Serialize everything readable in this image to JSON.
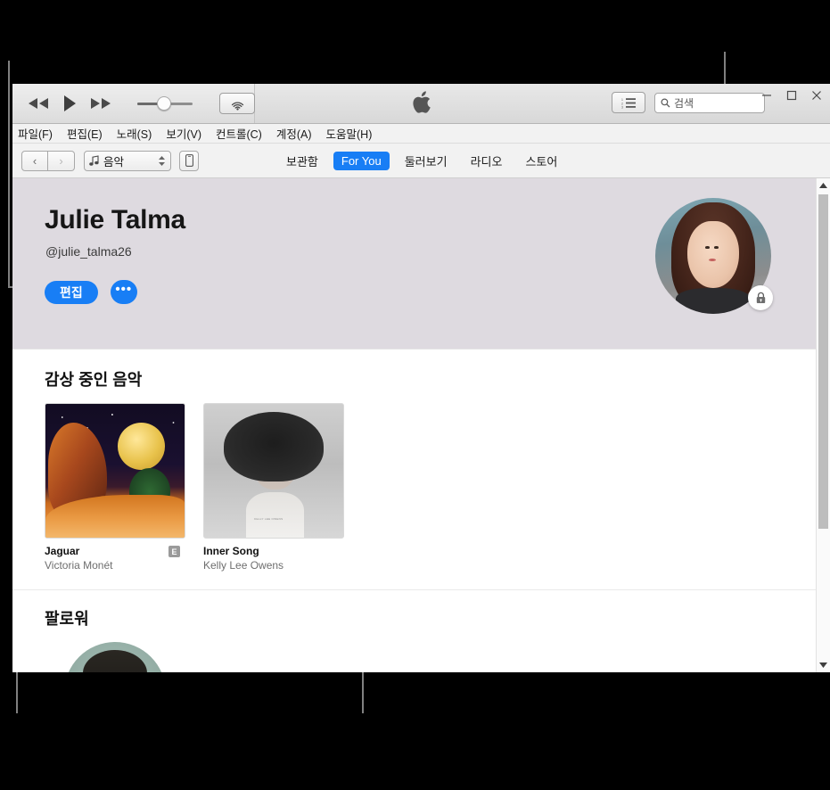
{
  "window": {
    "controls": {
      "minimize": "–",
      "maximize": "□",
      "close": "✕"
    }
  },
  "transport": {
    "rewind_label": "Rewind",
    "play_label": "Play",
    "forward_label": "Fast Forward",
    "volume_label": "Volume",
    "airplay_label": "AirPlay"
  },
  "toolbar": {
    "list_view_label": "List View",
    "search": {
      "placeholder": "검색",
      "value": ""
    }
  },
  "menubar": {
    "items": [
      {
        "label": "파일(F)"
      },
      {
        "label": "편집(E)"
      },
      {
        "label": "노래(S)"
      },
      {
        "label": "보기(V)"
      },
      {
        "label": "컨트롤(C)"
      },
      {
        "label": "계정(A)"
      },
      {
        "label": "도움말(H)"
      }
    ]
  },
  "navbar": {
    "back_label": "‹",
    "forward_label": "›",
    "source": {
      "label": "음악",
      "icon": "music-note-icon"
    },
    "device_label": "Device",
    "tabs": [
      {
        "label": "보관함",
        "active": false
      },
      {
        "label": "For You",
        "active": true
      },
      {
        "label": "둘러보기",
        "active": false
      },
      {
        "label": "라디오",
        "active": false
      },
      {
        "label": "스토어",
        "active": false
      }
    ]
  },
  "profile": {
    "name": "Julie Talma",
    "handle": "@julie_talma26",
    "edit_button": "편집",
    "more_button": "•••",
    "avatar_alt": "Julie Talma profile photo",
    "privacy_badge": "lock-icon"
  },
  "listening": {
    "section_title": "감상 중인 음악",
    "albums": [
      {
        "title": "Jaguar",
        "artist": "Victoria Monét",
        "explicit": true,
        "explicit_badge": "E"
      },
      {
        "title": "Inner Song",
        "artist": "Kelly Lee Owens",
        "explicit": false,
        "explicit_badge": ""
      }
    ]
  },
  "followers": {
    "section_title": "팔로워",
    "items": [
      {
        "avatar_alt": "Follower profile photo"
      }
    ]
  },
  "colors": {
    "accent": "#187ef5",
    "header_bg": "#dedae0",
    "callout": "#808080",
    "scrollbar_thumb": "#bdbdbd"
  }
}
